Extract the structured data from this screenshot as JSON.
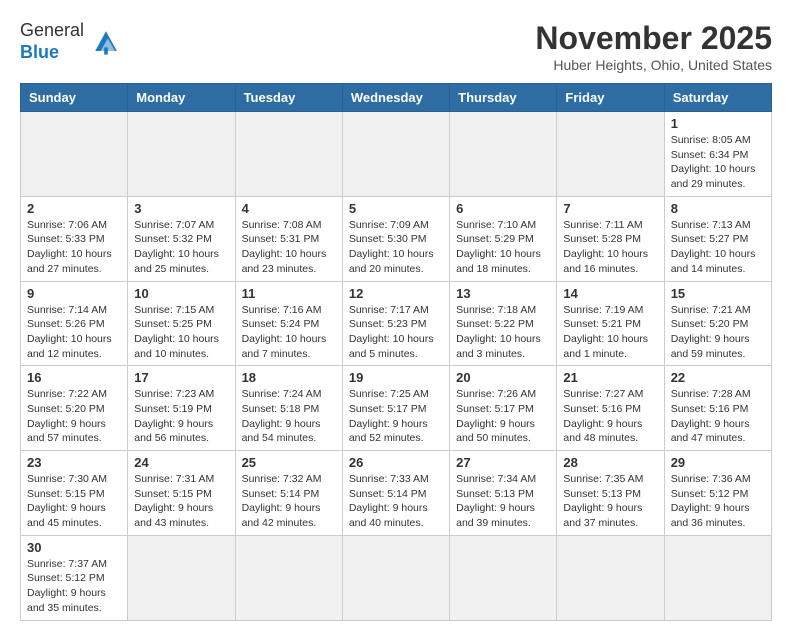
{
  "header": {
    "logo_line1": "General",
    "logo_line2": "Blue",
    "month_title": "November 2025",
    "location": "Huber Heights, Ohio, United States"
  },
  "days_of_week": [
    "Sunday",
    "Monday",
    "Tuesday",
    "Wednesday",
    "Thursday",
    "Friday",
    "Saturday"
  ],
  "weeks": [
    [
      {
        "day": "",
        "info": ""
      },
      {
        "day": "",
        "info": ""
      },
      {
        "day": "",
        "info": ""
      },
      {
        "day": "",
        "info": ""
      },
      {
        "day": "",
        "info": ""
      },
      {
        "day": "",
        "info": ""
      },
      {
        "day": "1",
        "info": "Sunrise: 8:05 AM\nSunset: 6:34 PM\nDaylight: 10 hours and 29 minutes."
      }
    ],
    [
      {
        "day": "2",
        "info": "Sunrise: 7:06 AM\nSunset: 5:33 PM\nDaylight: 10 hours and 27 minutes."
      },
      {
        "day": "3",
        "info": "Sunrise: 7:07 AM\nSunset: 5:32 PM\nDaylight: 10 hours and 25 minutes."
      },
      {
        "day": "4",
        "info": "Sunrise: 7:08 AM\nSunset: 5:31 PM\nDaylight: 10 hours and 23 minutes."
      },
      {
        "day": "5",
        "info": "Sunrise: 7:09 AM\nSunset: 5:30 PM\nDaylight: 10 hours and 20 minutes."
      },
      {
        "day": "6",
        "info": "Sunrise: 7:10 AM\nSunset: 5:29 PM\nDaylight: 10 hours and 18 minutes."
      },
      {
        "day": "7",
        "info": "Sunrise: 7:11 AM\nSunset: 5:28 PM\nDaylight: 10 hours and 16 minutes."
      },
      {
        "day": "8",
        "info": "Sunrise: 7:13 AM\nSunset: 5:27 PM\nDaylight: 10 hours and 14 minutes."
      }
    ],
    [
      {
        "day": "9",
        "info": "Sunrise: 7:14 AM\nSunset: 5:26 PM\nDaylight: 10 hours and 12 minutes."
      },
      {
        "day": "10",
        "info": "Sunrise: 7:15 AM\nSunset: 5:25 PM\nDaylight: 10 hours and 10 minutes."
      },
      {
        "day": "11",
        "info": "Sunrise: 7:16 AM\nSunset: 5:24 PM\nDaylight: 10 hours and 7 minutes."
      },
      {
        "day": "12",
        "info": "Sunrise: 7:17 AM\nSunset: 5:23 PM\nDaylight: 10 hours and 5 minutes."
      },
      {
        "day": "13",
        "info": "Sunrise: 7:18 AM\nSunset: 5:22 PM\nDaylight: 10 hours and 3 minutes."
      },
      {
        "day": "14",
        "info": "Sunrise: 7:19 AM\nSunset: 5:21 PM\nDaylight: 10 hours and 1 minute."
      },
      {
        "day": "15",
        "info": "Sunrise: 7:21 AM\nSunset: 5:20 PM\nDaylight: 9 hours and 59 minutes."
      }
    ],
    [
      {
        "day": "16",
        "info": "Sunrise: 7:22 AM\nSunset: 5:20 PM\nDaylight: 9 hours and 57 minutes."
      },
      {
        "day": "17",
        "info": "Sunrise: 7:23 AM\nSunset: 5:19 PM\nDaylight: 9 hours and 56 minutes."
      },
      {
        "day": "18",
        "info": "Sunrise: 7:24 AM\nSunset: 5:18 PM\nDaylight: 9 hours and 54 minutes."
      },
      {
        "day": "19",
        "info": "Sunrise: 7:25 AM\nSunset: 5:17 PM\nDaylight: 9 hours and 52 minutes."
      },
      {
        "day": "20",
        "info": "Sunrise: 7:26 AM\nSunset: 5:17 PM\nDaylight: 9 hours and 50 minutes."
      },
      {
        "day": "21",
        "info": "Sunrise: 7:27 AM\nSunset: 5:16 PM\nDaylight: 9 hours and 48 minutes."
      },
      {
        "day": "22",
        "info": "Sunrise: 7:28 AM\nSunset: 5:16 PM\nDaylight: 9 hours and 47 minutes."
      }
    ],
    [
      {
        "day": "23",
        "info": "Sunrise: 7:30 AM\nSunset: 5:15 PM\nDaylight: 9 hours and 45 minutes."
      },
      {
        "day": "24",
        "info": "Sunrise: 7:31 AM\nSunset: 5:15 PM\nDaylight: 9 hours and 43 minutes."
      },
      {
        "day": "25",
        "info": "Sunrise: 7:32 AM\nSunset: 5:14 PM\nDaylight: 9 hours and 42 minutes."
      },
      {
        "day": "26",
        "info": "Sunrise: 7:33 AM\nSunset: 5:14 PM\nDaylight: 9 hours and 40 minutes."
      },
      {
        "day": "27",
        "info": "Sunrise: 7:34 AM\nSunset: 5:13 PM\nDaylight: 9 hours and 39 minutes."
      },
      {
        "day": "28",
        "info": "Sunrise: 7:35 AM\nSunset: 5:13 PM\nDaylight: 9 hours and 37 minutes."
      },
      {
        "day": "29",
        "info": "Sunrise: 7:36 AM\nSunset: 5:12 PM\nDaylight: 9 hours and 36 minutes."
      }
    ],
    [
      {
        "day": "30",
        "info": "Sunrise: 7:37 AM\nSunset: 5:12 PM\nDaylight: 9 hours and 35 minutes."
      },
      {
        "day": "",
        "info": ""
      },
      {
        "day": "",
        "info": ""
      },
      {
        "day": "",
        "info": ""
      },
      {
        "day": "",
        "info": ""
      },
      {
        "day": "",
        "info": ""
      },
      {
        "day": "",
        "info": ""
      }
    ]
  ]
}
